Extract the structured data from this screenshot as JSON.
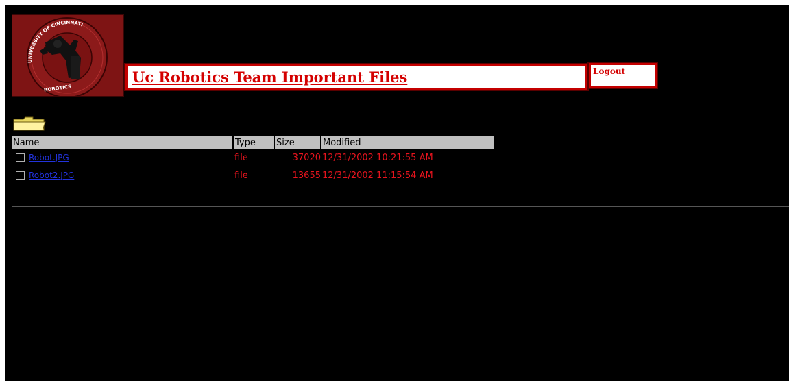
{
  "logo": {
    "arc_text": "UNIVERSITY OF CINCINNATI",
    "bottom_text": "ROBOTICS"
  },
  "header": {
    "title": "Uc Robotics Team Important Files",
    "logout_label": "Logout"
  },
  "icons": {
    "folder": "folder-icon",
    "checkbox": "checkbox-icon"
  },
  "table": {
    "columns": [
      "Name",
      "Type",
      "Size",
      "Modified"
    ],
    "rows": [
      {
        "name": "Robot.JPG",
        "type": "file",
        "size": "37020",
        "modified": "12/31/2002 10:21:55 AM"
      },
      {
        "name": "Robot2.JPG",
        "type": "file",
        "size": "13655",
        "modified": "12/31/2002 11:15:54 AM"
      }
    ]
  },
  "colors": {
    "background": "#000000",
    "accent_red": "#d40000",
    "header_gray": "#c0c0c0",
    "link_blue": "#2233dd"
  }
}
